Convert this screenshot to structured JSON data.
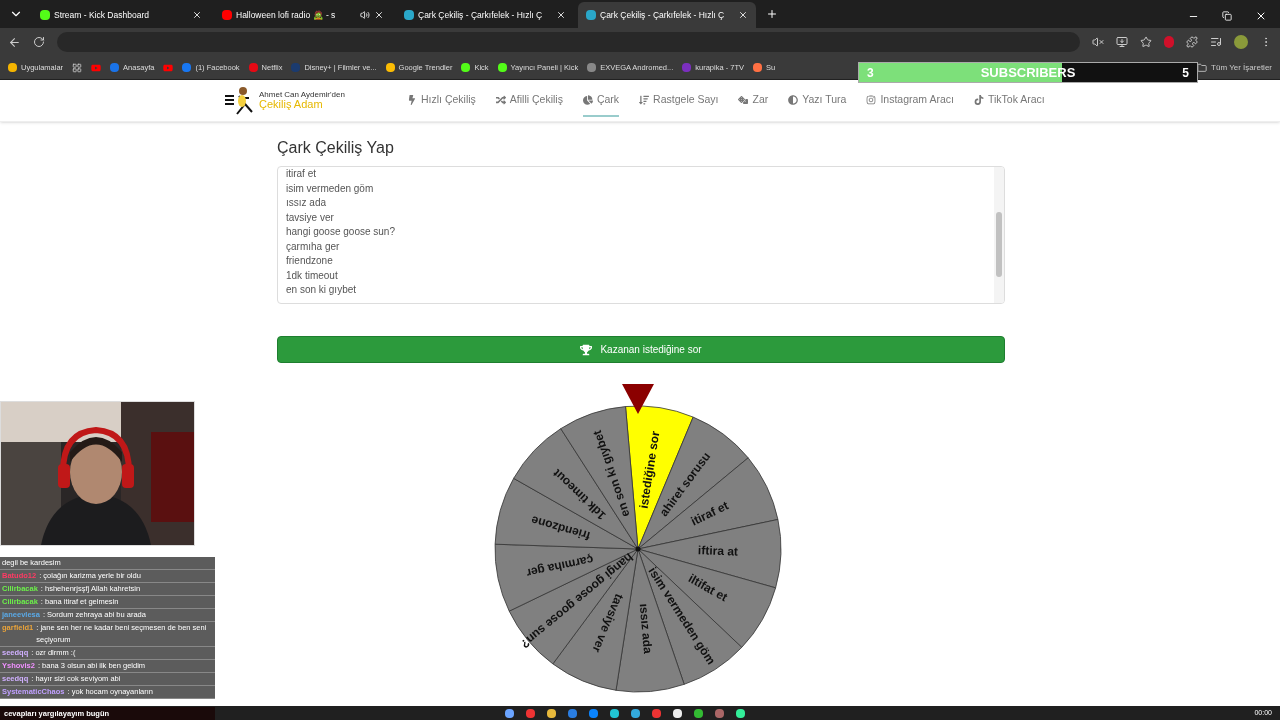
{
  "browser": {
    "tabs": [
      {
        "title": "Stream - Kick Dashboard",
        "selected": false,
        "audio": false
      },
      {
        "title": "Halloween lofi radio 🧟 - s",
        "selected": false,
        "audio": true
      },
      {
        "title": "Çark Çekiliş - Çarkıfelek - Hızlı Ç",
        "selected": false,
        "audio": false
      },
      {
        "title": "Çark Çekiliş - Çarkıfelek - Hızlı Ç",
        "selected": true,
        "audio": false
      }
    ],
    "bookmarks": [
      "Uygulamalar",
      "Anasayfa",
      "(1) Facebook",
      "Netflix",
      "Disney+ | Filmler ve...",
      "Google Trendler",
      "Kick",
      "Yayıncı Paneli | Kick",
      "EXVEGA Andromed...",
      "kurapika - 7TV",
      "Su"
    ],
    "all_bookmarks": "Tüm Yer İşaretler"
  },
  "subscribers": {
    "current": "3",
    "label": "SUBSCRIBERS",
    "goal": "5",
    "level": 0.6
  },
  "site": {
    "logo_top": "Ahmet Can Aydemir'den",
    "logo_name": "Çekiliş Adam",
    "nav": [
      {
        "label": "Hızlı Çekiliş",
        "selected": false
      },
      {
        "label": "Afilli Çekiliş",
        "selected": false
      },
      {
        "label": "Çark",
        "selected": true
      },
      {
        "label": "Rastgele Sayı",
        "selected": false
      },
      {
        "label": "Zar",
        "selected": false
      },
      {
        "label": "Yazı Tura",
        "selected": false
      },
      {
        "label": "Instagram Aracı",
        "selected": false
      },
      {
        "label": "TikTok Aracı",
        "selected": false
      }
    ],
    "heading": "Çark Çekiliş Yap",
    "entries": [
      "itiraf et",
      "isim vermeden göm",
      "ıssız ada",
      "tavsiye ver",
      "hangi goose goose sun?",
      "çarmıha ger",
      "friendzone",
      "1dk timeout",
      "en son ki gıybet"
    ],
    "spin_button": "Kazanan istediğine sor",
    "wheel": [
      {
        "label": "istediğine sor",
        "selected": true
      },
      {
        "label": "ahiret sorusu",
        "selected": false
      },
      {
        "label": "itiraf et",
        "selected": false
      },
      {
        "label": "iftira at",
        "selected": false
      },
      {
        "label": "iltifat et",
        "selected": false
      },
      {
        "label": "isim vermeden göm",
        "selected": false
      },
      {
        "label": "ıssız ada",
        "selected": false
      },
      {
        "label": "tavsiye ver",
        "selected": false
      },
      {
        "label": "hangi goose goose sun?",
        "selected": false
      },
      {
        "label": "çarmıha ger",
        "selected": false
      },
      {
        "label": "friendzone",
        "selected": false
      },
      {
        "label": "1dk timeout",
        "selected": false
      },
      {
        "label": "en son ki gıybet",
        "selected": false
      }
    ]
  },
  "chat": {
    "messages": [
      {
        "text": "degil be kardesim"
      },
      {
        "user": "Batudo12",
        "color": "#ff3a64",
        "text": ": çolağın karizma yerle bir oldu"
      },
      {
        "user": "Cilirbacak",
        "color": "#6cf04a",
        "text": ": hshehenrjsşfj Allah kahretsin"
      },
      {
        "user": "Cilirbacak",
        "color": "#6cf04a",
        "text": ": bana itiraf et gelmesin"
      },
      {
        "user": "janeevlesa",
        "color": "#5aa9e6",
        "text": ": Sordum zehraya abi bu arada"
      },
      {
        "user": "garfield1",
        "color": "#e8a23a",
        "text": ": jane sen her ne kadar beni seçmesen de ben seni seçiyorum"
      },
      {
        "user": "seedqq",
        "color": "#d0b0ff",
        "text": ": ozr dlrmm :("
      },
      {
        "user": "Yshovis2",
        "color": "#f090ff",
        "text": ": bana 3 olsun abi ilk ben geldim"
      },
      {
        "user": "seedqq",
        "color": "#d0b0ff",
        "text": ": hayır sizi cok seviyom abi"
      },
      {
        "user": "SystematicChaos",
        "color": "#c0a0ff",
        "text": ": yok hocam oynayanların"
      }
    ],
    "caption": "cevapları yargılayayım bugün"
  },
  "taskbar": {
    "clock": "00:00"
  }
}
